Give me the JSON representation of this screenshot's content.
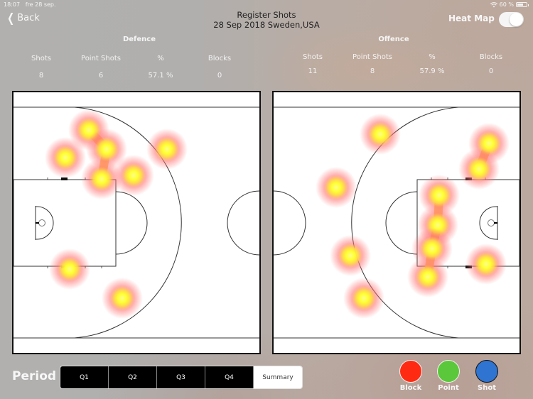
{
  "status_bar": {
    "time": "18:07",
    "date": "fre 28 sep.",
    "wifi_icon": "wifi-icon",
    "battery": "60 %"
  },
  "nav": {
    "back_label": "Back",
    "back_icon": "chevron-left-icon",
    "title": "Register Shots",
    "subtitle": "28 Sep 2018 Sweden,USA",
    "heatmap_label": "Heat Map",
    "heatmap_on": true
  },
  "defence": {
    "title": "Defence",
    "headers": [
      "Shots",
      "Point Shots",
      "%",
      "Blocks"
    ],
    "values": [
      "8",
      "6",
      "57.1 %",
      "0"
    ]
  },
  "offence": {
    "title": "Offence",
    "headers": [
      "Shots",
      "Point Shots",
      "%",
      "Blocks"
    ],
    "values": [
      "11",
      "8",
      "57.9 %",
      "0"
    ]
  },
  "courts": {
    "defence_spots": 8,
    "offence_spots": 11
  },
  "period": {
    "label": "Period",
    "options": [
      "Q1",
      "Q2",
      "Q3",
      "Q4",
      "Summary"
    ],
    "selected": "Summary"
  },
  "legend": [
    {
      "label": "Block",
      "color": "#ff2a12"
    },
    {
      "label": "Point",
      "color": "#5ac83a"
    },
    {
      "label": "Shot",
      "color": "#2f74d0"
    }
  ]
}
